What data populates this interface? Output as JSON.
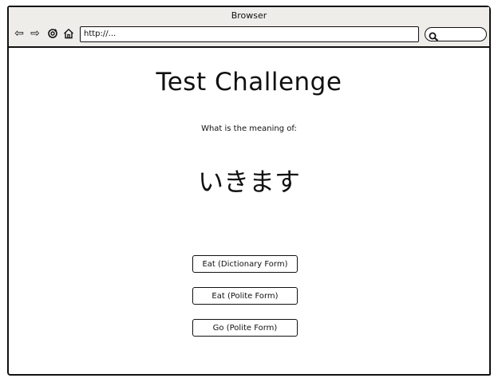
{
  "browser": {
    "title": "Browser",
    "url": "http://...",
    "icons": [
      "back-arrow-icon",
      "forward-arrow-icon",
      "reload-icon",
      "home-icon",
      "search-icon"
    ]
  },
  "page": {
    "title": "Test Challenge",
    "prompt": "What is the meaning of:",
    "word": "いきます",
    "answers": [
      {
        "label": "Eat (Dictionary Form)"
      },
      {
        "label": "Eat (Polite Form)"
      },
      {
        "label": "Go (Polite Form)"
      }
    ]
  }
}
